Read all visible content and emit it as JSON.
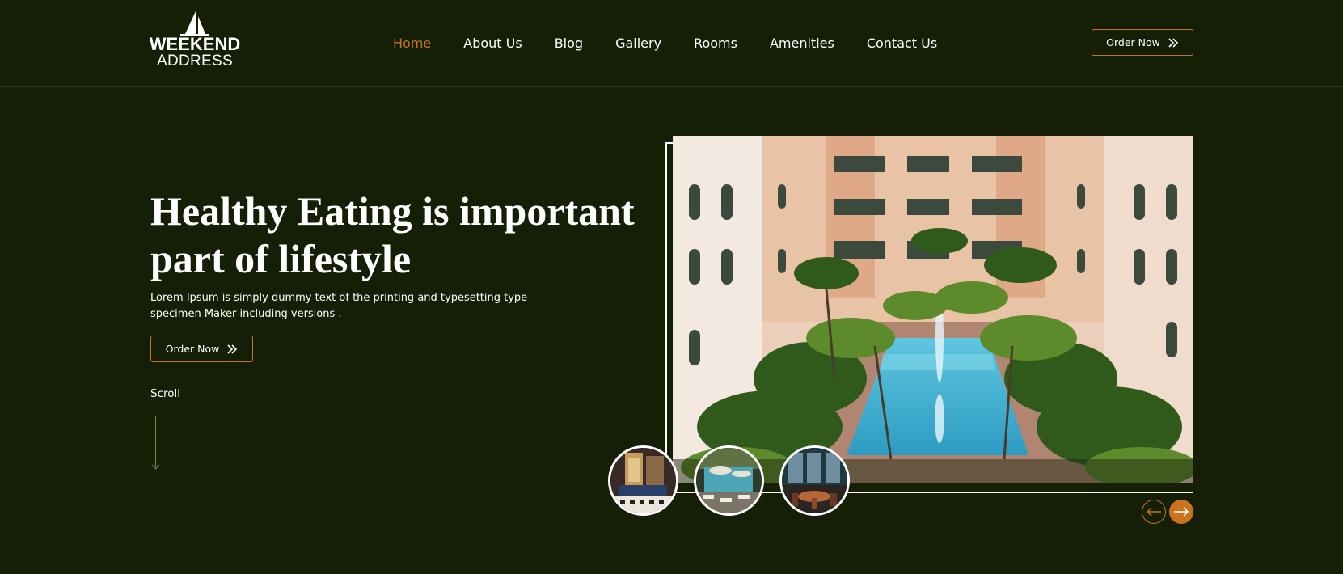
{
  "logo": {
    "line1": "WEEKEND",
    "line2": "ADDRESS",
    "icon": "sailboat-icon"
  },
  "nav": {
    "items": [
      {
        "label": "Home",
        "active": true
      },
      {
        "label": "About Us",
        "active": false
      },
      {
        "label": "Blog",
        "active": false
      },
      {
        "label": "Gallery",
        "active": false
      },
      {
        "label": "Rooms",
        "active": false
      },
      {
        "label": "Amenities",
        "active": false
      },
      {
        "label": "Contact Us",
        "active": false
      }
    ]
  },
  "header": {
    "cta_label": "Order Now",
    "cta_icon": "double-chevron-right-icon"
  },
  "hero": {
    "title": "Healthy Eating is important part of lifestyle",
    "description": "Lorem Ipsum is simply dummy text of the printing and typesetting type specimen Maker including versions .",
    "cta_label": "Order Now",
    "cta_icon": "double-chevron-right-icon",
    "scroll_label": "Scroll",
    "scroll_icon": "arrow-down-icon"
  },
  "gallery": {
    "main_image": "hotel-courtyard-pool-image",
    "thumbnails": [
      "hotel-lobby-thumbnail",
      "pool-deck-thumbnail",
      "dining-room-thumbnail"
    ],
    "prev_icon": "arrow-left-icon",
    "next_icon": "arrow-right-icon"
  },
  "colors": {
    "background": "#141f06",
    "accent": "#c9731a",
    "text": "#ffffff"
  }
}
